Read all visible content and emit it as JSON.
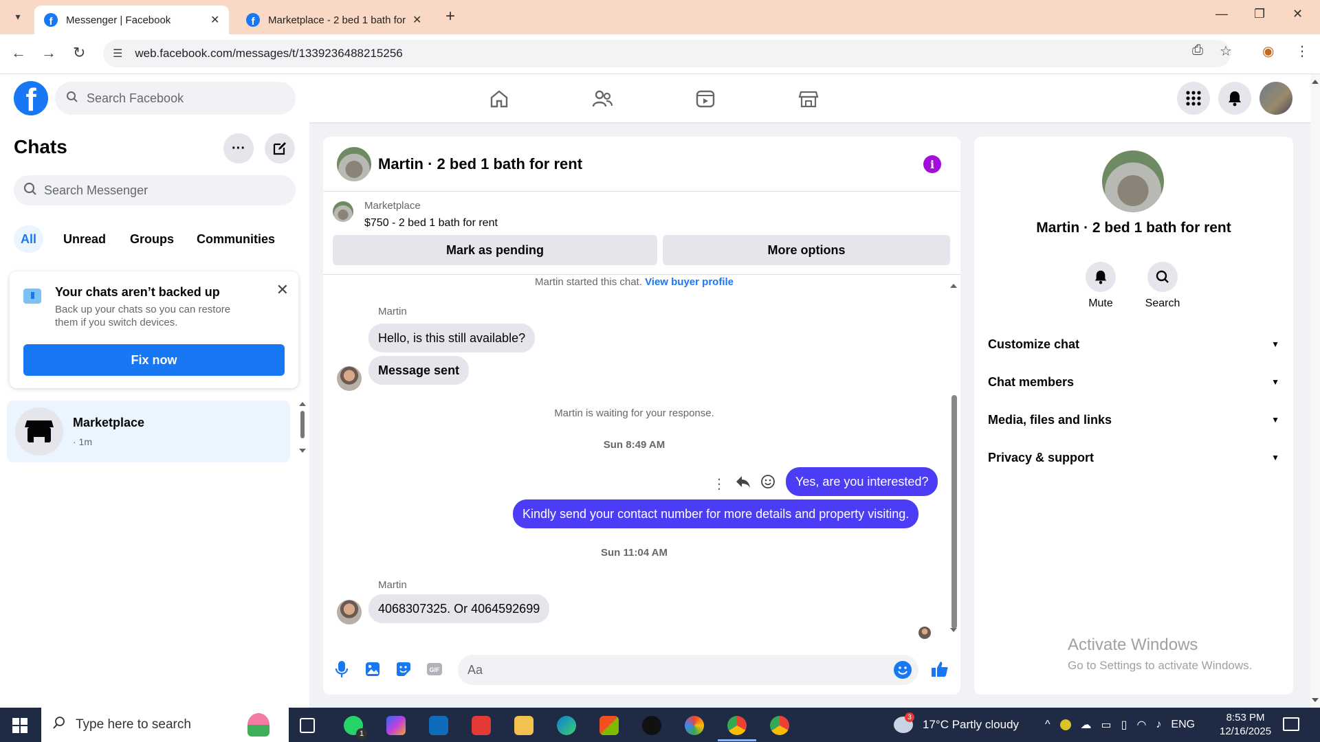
{
  "browser": {
    "tabs": [
      {
        "title": "Messenger | Facebook",
        "active": true
      },
      {
        "title": "Marketplace - 2 bed 1 bath for",
        "active": false
      }
    ],
    "url": "web.facebook.com/messages/t/1339236488215256",
    "new_tab_label": "+"
  },
  "facebook": {
    "logo": "f",
    "search_placeholder": "Search Facebook",
    "nav_icons": [
      "home-icon",
      "friends-icon",
      "video-icon",
      "marketplace-icon"
    ]
  },
  "chats": {
    "title": "Chats",
    "more_glyph": "···",
    "search_placeholder": "Search Messenger",
    "filters": [
      "All",
      "Unread",
      "Groups",
      "Communities"
    ],
    "active_filter": "All",
    "backup_banner": {
      "title": "Your chats aren’t backed up",
      "description": "Back up your chats so you can restore them if you switch devices.",
      "button": "Fix now"
    },
    "items": [
      {
        "name": "Marketplace",
        "time": "· 1m"
      }
    ]
  },
  "conversation": {
    "title": "Martin · 2 bed 1 bath for rent",
    "listing": {
      "source": "Marketplace",
      "price_title": "$750 - 2 bed 1 bath for rent",
      "mark_pending": "Mark as pending",
      "more_options": "More options"
    },
    "started_text": "Martin started this chat.",
    "view_profile": "View buyer profile",
    "messages": {
      "sender_1": "Martin",
      "in_1": "Hello, is this still available?",
      "in_2": "Message sent",
      "waiting": "Martin is waiting for your response.",
      "time_1": "Sun 8:49 AM",
      "out_1": "Yes, are you interested?",
      "out_2": "Kindly send your contact number for more details and property visiting.",
      "time_2": "Sun 11:04 AM",
      "sender_2": "Martin",
      "in_3": "4068307325. Or  4064592699"
    },
    "composer_placeholder": "Aa",
    "accent_color": "#4b3cf5"
  },
  "details": {
    "title": "Martin · 2 bed 1 bath for rent",
    "actions": [
      {
        "label": "Mute",
        "icon": "bell-icon"
      },
      {
        "label": "Search",
        "icon": "search-icon"
      }
    ],
    "sections": [
      "Customize chat",
      "Chat members",
      "Media, files and links",
      "Privacy & support"
    ]
  },
  "watermark": {
    "line1": "Activate Windows",
    "line2": "Go to Settings to activate Windows."
  },
  "taskbar": {
    "search_placeholder": "Type here to search",
    "whatsapp_badge": "1",
    "weather_badge": "3",
    "weather": "17°C  Partly cloudy",
    "language": "ENG",
    "time": "8:53 PM",
    "date": "12/16/2025"
  }
}
